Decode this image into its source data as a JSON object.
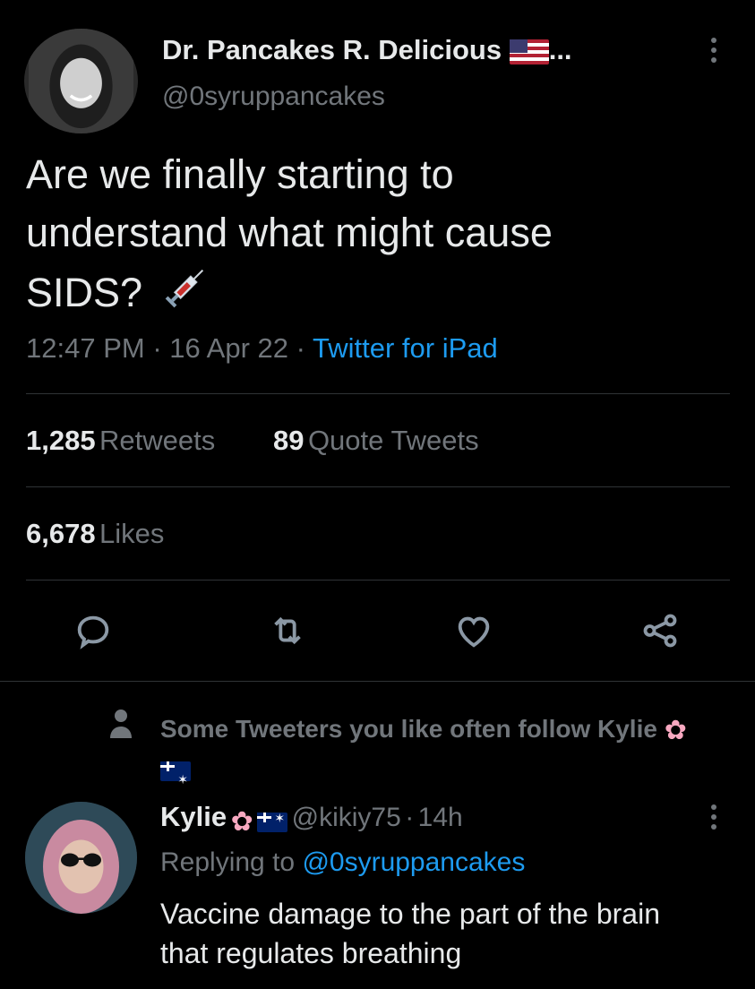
{
  "tweet": {
    "author_name": "Dr. Pancakes R. Delicious",
    "author_flag_icon": "us-flag-icon",
    "name_truncation": "...",
    "author_handle": "@0syruppancakes",
    "more_label": "⋮",
    "text_line1": "Are we finally starting to",
    "text_line2": "understand what might cause",
    "text_line3": "SIDS?",
    "emoji_icon": "syringe-icon",
    "time": "12:47 PM",
    "date": "16 Apr 22",
    "sep": "·",
    "source": "Twitter for iPad"
  },
  "stats": {
    "retweets_count": "1,285",
    "retweets_label": "Retweets",
    "quotes_count": "89",
    "quotes_label": "Quote Tweets",
    "likes_count": "6,678",
    "likes_label": "Likes"
  },
  "actions": [
    "reply-icon",
    "retweet-icon",
    "like-icon",
    "share-icon"
  ],
  "social_context": {
    "icon": "person-icon",
    "text": "Some Tweeters you like often follow Kylie",
    "emojis": [
      "cherry-blossom-icon",
      "au-flag-icon"
    ]
  },
  "reply": {
    "author_name": "Kylie",
    "author_handle": "@kikiy75",
    "sep": "·",
    "time": "14h",
    "more_label": "⋮",
    "replying_prefix": "Replying to",
    "replying_to": "@0syruppancakes",
    "text_line1": "Vaccine damage to the part of the brain",
    "text_line2": "that regulates breathing"
  },
  "colors": {
    "background": "#000000",
    "text": "#e7e9ea",
    "muted": "#71767b",
    "link": "#1d9bf0",
    "divider": "#2f3336"
  }
}
